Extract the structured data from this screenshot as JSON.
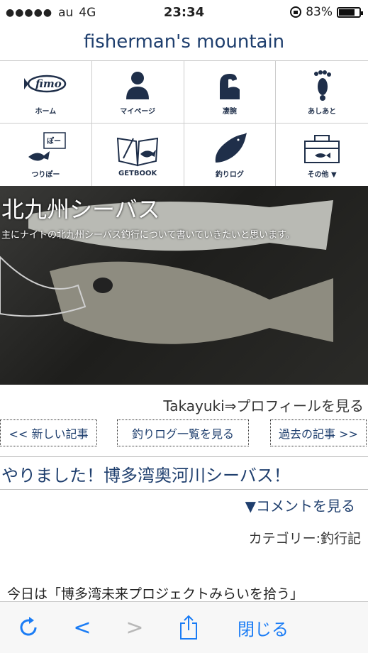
{
  "status_bar": {
    "signal": "●●●●●",
    "carrier": "au",
    "network": "4G",
    "time": "23:34",
    "battery_percent": "83%",
    "battery_level": 0.83
  },
  "site": {
    "title": "fisherman's mountain"
  },
  "nav": {
    "items": [
      {
        "label": "ホーム",
        "icon": "fimo-logo-icon"
      },
      {
        "label": "マイページ",
        "icon": "person-icon"
      },
      {
        "label": "凄腕",
        "icon": "arm-icon"
      },
      {
        "label": "あしあと",
        "icon": "footprint-icon"
      },
      {
        "label": "つりぽー",
        "icon": "fish-speech-icon",
        "bubble": "ぽ゚ー"
      },
      {
        "label": "GETBOOK",
        "icon": "book-icon"
      },
      {
        "label": "釣りログ",
        "icon": "fish-icon"
      },
      {
        "label": "その他 ▼",
        "icon": "tackle-box-icon"
      }
    ]
  },
  "hero": {
    "title": "北九州シーバス",
    "subtitle": "主にナイトの北九州シーバス釣行について書いていきたいと思います。"
  },
  "profile_link": "Takayuki⇒プロフィールを見る",
  "article_nav": {
    "newer": "<< 新しい記事",
    "list": "釣りログ一覧を見る",
    "older": "過去の記事 >>"
  },
  "post": {
    "title": "やりました！博多湾奥河川シーバス！",
    "comment_link": "▼コメントを見る",
    "category": "カテゴリー:釣行記",
    "body_first_line": "今日は「博多湾未来プロジェクトみらいを拾う」"
  },
  "toolbar": {
    "back": "<",
    "forward": ">",
    "close": "閉じる",
    "accent": "#1a7cf5"
  }
}
